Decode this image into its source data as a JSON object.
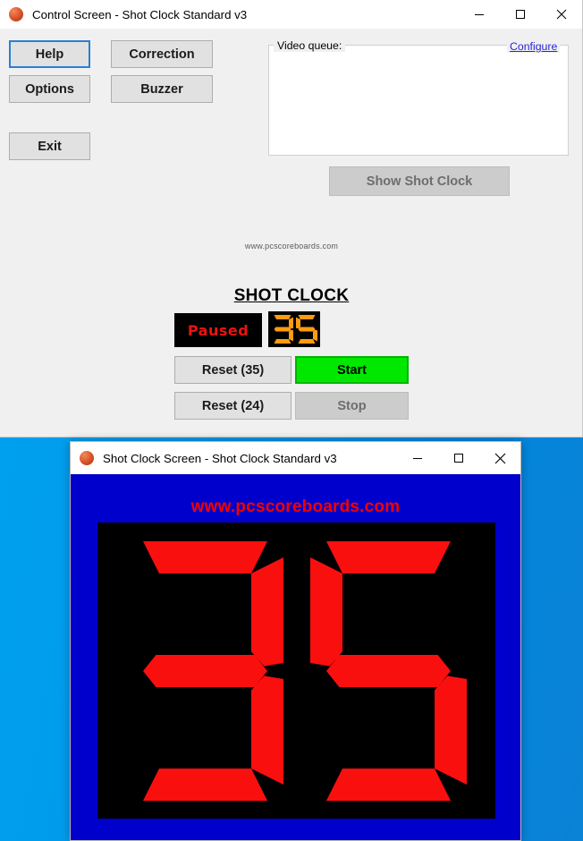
{
  "desktop": {
    "background_color": "#0096e6"
  },
  "control_window": {
    "title": "Control Screen - Shot Clock Standard v3",
    "icon": "basketball-icon",
    "window_controls": {
      "minimize": "—",
      "maximize": "□",
      "close": "✕"
    },
    "buttons": {
      "help": "Help",
      "correction": "Correction",
      "options": "Options",
      "buzzer": "Buzzer",
      "exit": "Exit",
      "show_shot_clock": "Show Shot Clock"
    },
    "video_queue": {
      "legend": "Video queue:",
      "configure_link": "Configure",
      "items": []
    },
    "site_text": "www.pcscoreboards.com",
    "shot_clock": {
      "heading": "SHOT CLOCK",
      "status": "Paused",
      "status_color": "#ee1111",
      "value": "35",
      "digits": [
        "3",
        "5"
      ],
      "digit_color": "#ff9b0f",
      "panel_color": "#000000",
      "controls": {
        "reset_35": "Reset (35)",
        "reset_24": "Reset (24)",
        "start": "Start",
        "stop": "Stop"
      },
      "start_color": "#00e800"
    }
  },
  "clock_window": {
    "title": "Shot Clock Screen - Shot Clock Standard v3",
    "icon": "basketball-icon",
    "window_controls": {
      "minimize": "—",
      "maximize": "□",
      "close": "✕"
    },
    "site_text": "www.pcscoreboards.com",
    "site_text_color": "#f40000",
    "background_color": "#0000cc",
    "display": {
      "value": "35",
      "digits": [
        "3",
        "5"
      ],
      "digit_color": "#fa0f0f",
      "panel_color": "#000000"
    }
  }
}
